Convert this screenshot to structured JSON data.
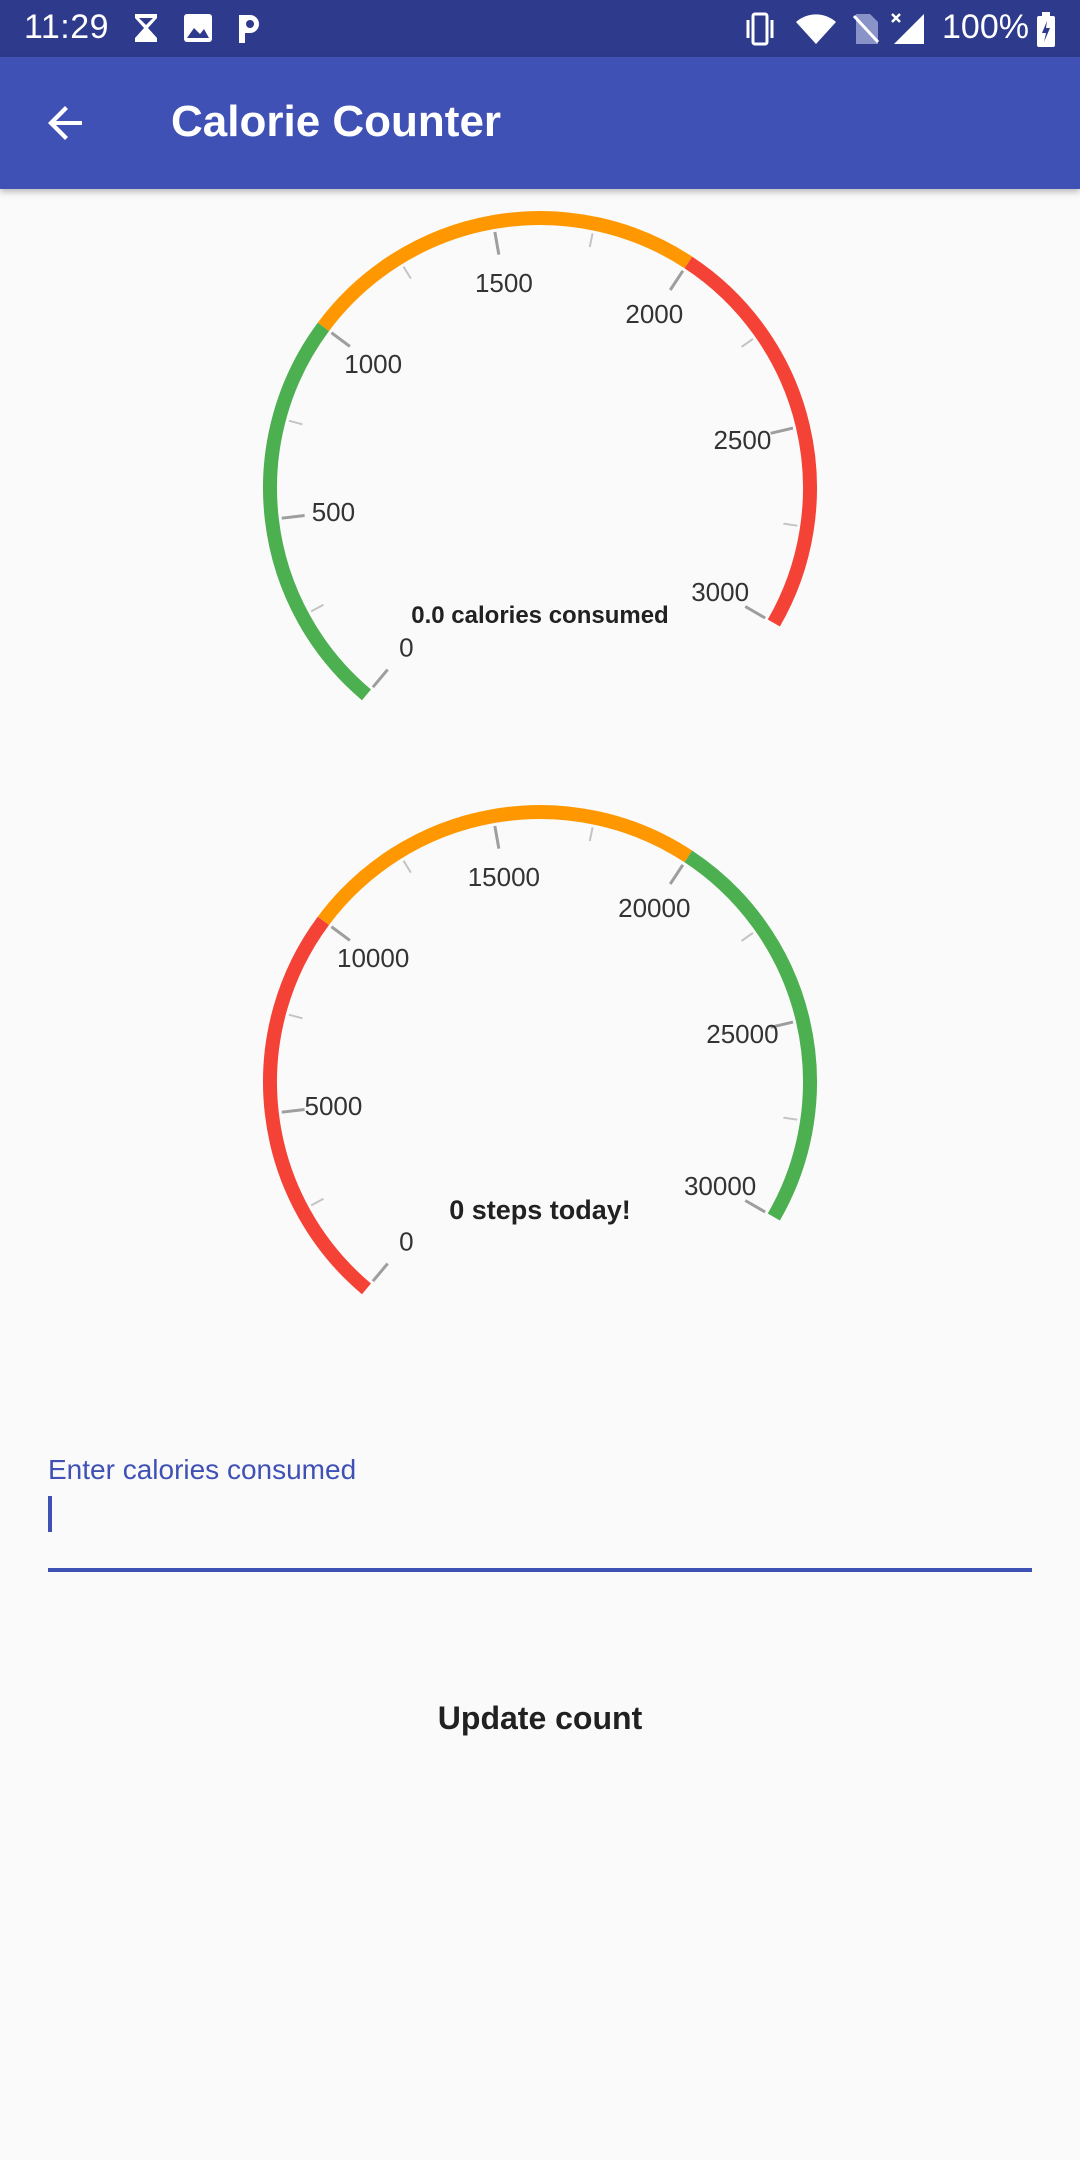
{
  "status_bar": {
    "time": "11:29",
    "battery": "100%",
    "icons": [
      "hourglass-icon",
      "image-icon",
      "p-app-icon",
      "vibrate-icon",
      "wifi-icon",
      "no-sim-icon",
      "signal-icon",
      "battery-charging-icon"
    ]
  },
  "app_bar": {
    "title": "Calorie Counter",
    "back_icon": "arrow-back-icon",
    "color": "#3f51b5"
  },
  "gauges": [
    {
      "id": "calories",
      "min": 0,
      "max": 3000,
      "value": 0,
      "tick_labels": [
        "0",
        "500",
        "1000",
        "1500",
        "2000",
        "2500",
        "3000"
      ],
      "segments": [
        {
          "from": 0,
          "to": 1000,
          "color": "#4caf50"
        },
        {
          "from": 1000,
          "to": 2000,
          "color": "#ff9800"
        },
        {
          "from": 2000,
          "to": 3000,
          "color": "#f44336"
        }
      ],
      "caption": "0.0 calories consumed"
    },
    {
      "id": "steps",
      "min": 0,
      "max": 30000,
      "value": 0,
      "tick_labels": [
        "0",
        "5000",
        "10000",
        "15000",
        "20000",
        "25000",
        "30000"
      ],
      "segments": [
        {
          "from": 0,
          "to": 10000,
          "color": "#f44336"
        },
        {
          "from": 10000,
          "to": 20000,
          "color": "#ff9800"
        },
        {
          "from": 20000,
          "to": 30000,
          "color": "#4caf50"
        }
      ],
      "caption": "0 steps today!"
    }
  ],
  "calorie_input": {
    "label": "Enter calories consumed",
    "value": "",
    "accent": "#3f51b5"
  },
  "update_button": {
    "label": "Update count"
  }
}
